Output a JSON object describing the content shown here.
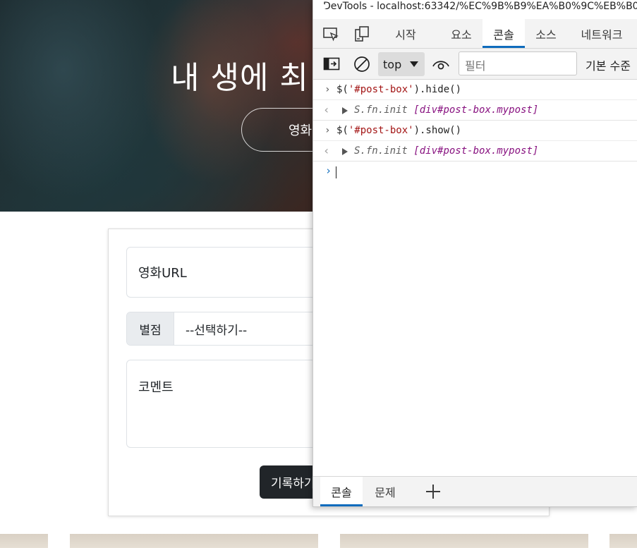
{
  "page": {
    "hero_title": "내 생에 최",
    "hero_button": "영화",
    "url_placeholder": "영화URL",
    "stars_label": "별점",
    "stars_select": "--선택하기--",
    "comment_placeholder": "코멘트",
    "record_button": "기록하기"
  },
  "devtools": {
    "title": "DevTools - localhost:63342/%EC%9B%B9%EA%B0%9C%EB%B0%",
    "tabs": [
      {
        "label": "시작",
        "active": false
      },
      {
        "label": "요소",
        "active": false
      },
      {
        "label": "콘솔",
        "active": true
      },
      {
        "label": "소스",
        "active": false
      },
      {
        "label": "네트워크",
        "active": false
      }
    ],
    "toolbar": {
      "context": "top",
      "filter_placeholder": "필터",
      "level": "기본 수준"
    },
    "console": {
      "entries": [
        {
          "prefix": "$(",
          "str": "'#post-box'",
          "suffix": ").hide()",
          "result_text": "S.fn.init ",
          "result_node": "[div#post-box.mypost]"
        },
        {
          "prefix": "$(",
          "str": "'#post-box'",
          "suffix": ").show()",
          "result_text": "S.fn.init ",
          "result_node": "[div#post-box.mypost]"
        }
      ],
      "prompt_glyph": "›",
      "result_glyph": "‹",
      "input_glyph": "›"
    },
    "drawer": {
      "tabs": [
        {
          "label": "콘솔",
          "active": true
        },
        {
          "label": "문제",
          "active": false
        }
      ]
    }
  }
}
